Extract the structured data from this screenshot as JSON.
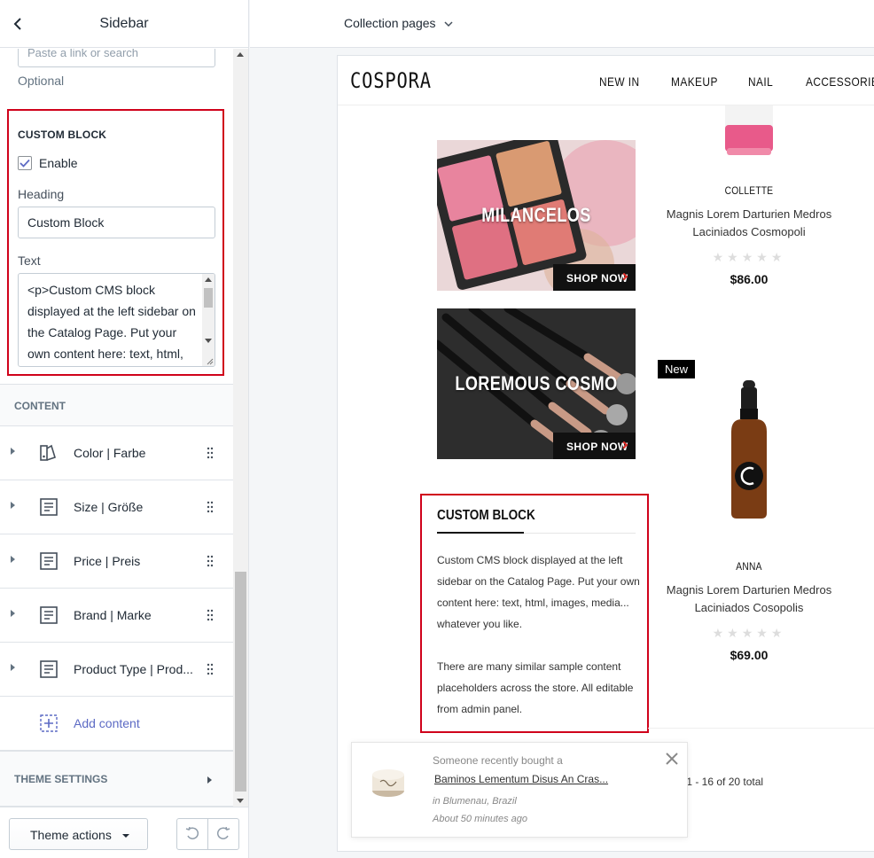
{
  "panel": {
    "title": "Sidebar",
    "link_placeholder": "Paste a link or search",
    "optional_label": "Optional",
    "custom_block": {
      "title": "CUSTOM BLOCK",
      "enable_label": "Enable",
      "enable_checked": true,
      "heading_label": "Heading",
      "heading_value": "Custom Block",
      "text_label": "Text",
      "text_value": "<p>Custom CMS block displayed at the left sidebar on the Catalog Page. Put your own content here: text, html,"
    },
    "content_section": "CONTENT",
    "content_items": [
      {
        "label": "Color | Farbe",
        "icon": "color-filter-icon"
      },
      {
        "label": "Size | Größe",
        "icon": "text-block-icon"
      },
      {
        "label": "Price | Preis",
        "icon": "text-block-icon"
      },
      {
        "label": "Brand | Marke",
        "icon": "text-block-icon"
      },
      {
        "label": "Product Type | Prod...",
        "icon": "text-block-icon"
      }
    ],
    "add_content": "Add content",
    "theme_settings": "THEME SETTINGS",
    "theme_actions": "Theme actions"
  },
  "topbar": {
    "page_select": "Collection pages"
  },
  "store": {
    "logo": "COSPORA",
    "nav": [
      "NEW IN",
      "MAKEUP",
      "NAIL",
      "ACCESSORIES"
    ],
    "banners": [
      {
        "title": "MILANCELOS",
        "cta": "SHOP NOW"
      },
      {
        "title": "LOREMOUS COSMO",
        "cta": "SHOP NOW"
      }
    ],
    "products": [
      {
        "brand": "COLLETTE",
        "name": "Magnis Lorem Darturien Medros Laciniados Cosmopoli",
        "stars": "★★★★★",
        "price": "$86.00"
      },
      {
        "brand": "ANNA",
        "name": "Magnis Lorem Darturien Medros Laciniados Cosopolis",
        "stars": "★★★★★",
        "price": "$69.00"
      }
    ],
    "new_badge": "New",
    "cms": {
      "title": "CUSTOM BLOCK",
      "p1": "Custom CMS block displayed at the left sidebar on the Catalog Page. Put your own content here: text, html, images, media... whatever you like.",
      "p2": "There are many similar sample content placeholders across the store. All editable from admin panel."
    },
    "pager": "g: 1 - 16 of 20 total",
    "toast": {
      "intro": "Someone recently bought a",
      "product": "Baminos Lementum Disus An Cras...",
      "location": "in Blumenau, Brazil",
      "time": "About 50 minutes ago"
    }
  },
  "colors": {
    "highlight": "#d0021b",
    "accent_link": "#5c6ac4",
    "arrow": "#e02b27"
  }
}
